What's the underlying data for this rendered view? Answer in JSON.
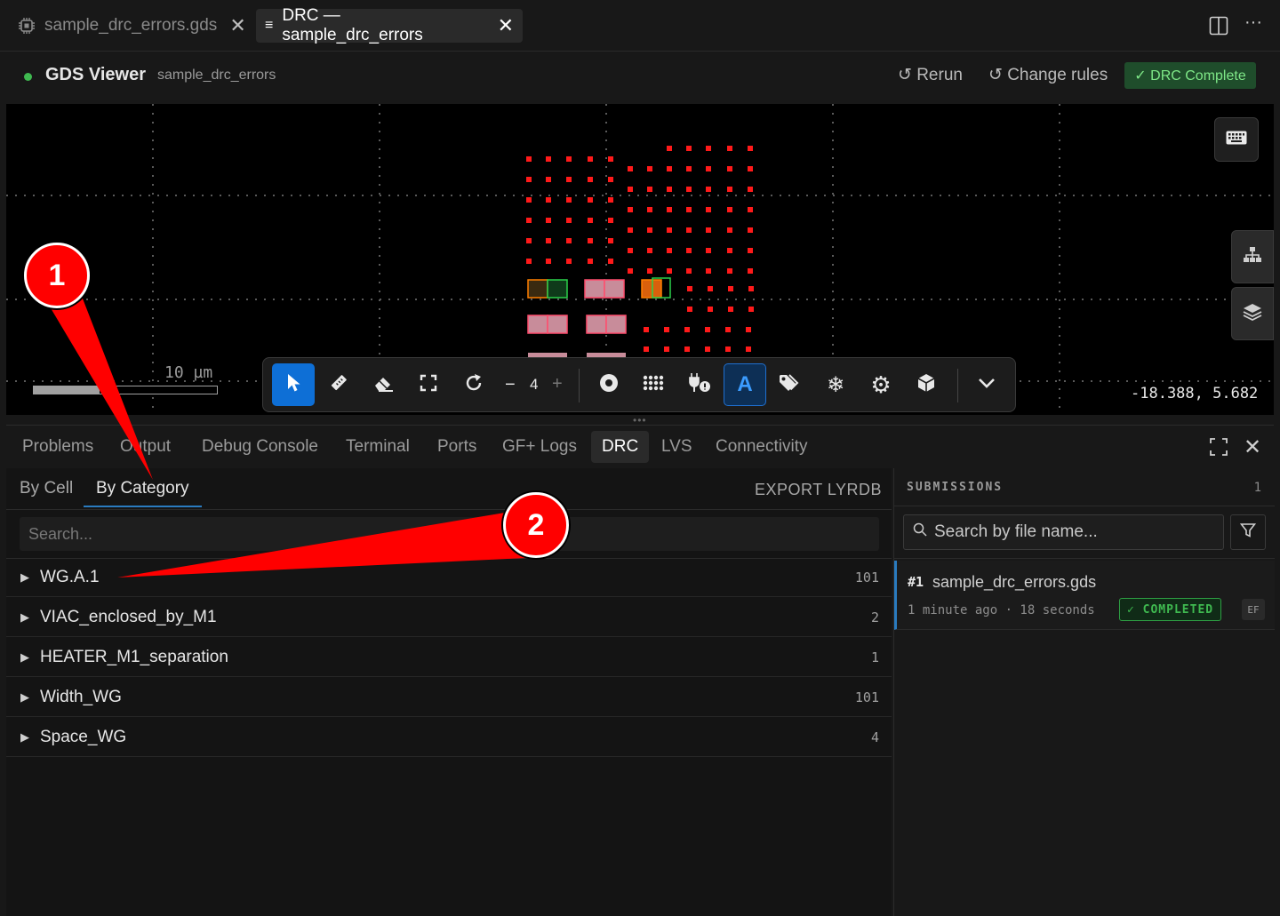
{
  "tabs": [
    {
      "label": "sample_drc_errors.gds",
      "icon": "chip-icon",
      "active": false
    },
    {
      "label": "DRC — sample_drc_errors",
      "icon": "list-icon",
      "active": true
    }
  ],
  "viewer": {
    "title": "GDS Viewer",
    "file": "sample_drc_errors",
    "rerun": "Rerun",
    "change_rules": "Change rules",
    "status": "✓ DRC Complete",
    "scale_label": "10 µm",
    "coords": "-18.388, 5.682",
    "zoom_value": "4"
  },
  "panel_tabs": [
    "Problems",
    "Output",
    "Debug Console",
    "Terminal",
    "Ports",
    "GF+ Logs",
    "DRC",
    "LVS",
    "Connectivity"
  ],
  "drc": {
    "sub_tabs": [
      "By Cell",
      "By Category"
    ],
    "export": "EXPORT LYRDB",
    "search_placeholder": "Search...",
    "categories": [
      {
        "name": "WG.A.1",
        "count": "101"
      },
      {
        "name": "VIAC_enclosed_by_M1",
        "count": "2"
      },
      {
        "name": "HEATER_M1_separation",
        "count": "1"
      },
      {
        "name": "Width_WG",
        "count": "101"
      },
      {
        "name": "Space_WG",
        "count": "4"
      }
    ]
  },
  "submissions": {
    "title": "SUBMISSIONS",
    "count": "1",
    "search_placeholder": "Search by file name...",
    "items": [
      {
        "num": "#1",
        "file": "sample_drc_errors.gds",
        "meta": "1 minute ago · 18 seconds",
        "status": "✓ COMPLETED",
        "tag": "EF"
      }
    ]
  },
  "callouts": [
    "1",
    "2"
  ],
  "colors": {
    "accent": "#0e6fd6",
    "error_red": "#ff1a1a",
    "success": "#3fb950"
  }
}
